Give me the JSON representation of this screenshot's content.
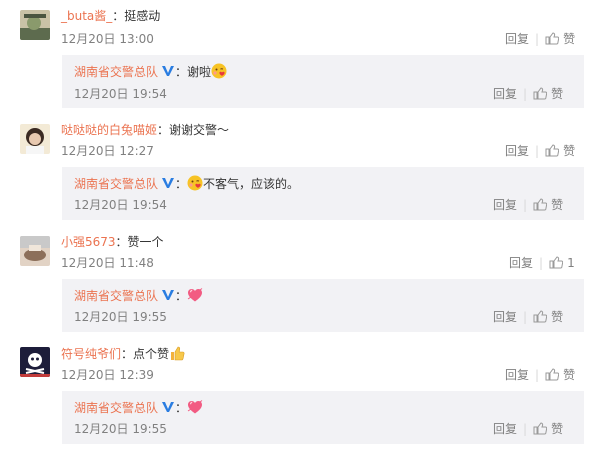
{
  "comments": [
    {
      "user": "_buta酱_",
      "text": "：挺感动",
      "time": "12月20日 13:00",
      "reply_label": "回复",
      "like_label": "赞",
      "like_count": "",
      "avatar_colors": [
        "#5d6b4e",
        "#8a9a6c",
        "#c9c2a6"
      ],
      "reply": {
        "user": "湖南省交警总队",
        "text": "：谢啦",
        "emoji": "kiss-emoji",
        "time": "12月20日 19:54",
        "reply_label": "回复",
        "like_label": "赞"
      }
    },
    {
      "user": "哒哒哒的白兔喵姬",
      "text": "：谢谢交警～",
      "time": "12月20日 12:27",
      "reply_label": "回复",
      "like_label": "赞",
      "like_count": "",
      "avatar_colors": [
        "#f3ead6",
        "#3b2a22",
        "#e8c9b0"
      ],
      "reply": {
        "user": "湖南省交警总队",
        "text": "不客气，应该的。",
        "prefix": "：",
        "emoji": "kiss-emoji",
        "time": "12月20日 19:54",
        "reply_label": "回复",
        "like_label": "赞"
      }
    },
    {
      "user": "小强5673",
      "text": "：赞一个",
      "time": "12月20日 11:48",
      "reply_label": "回复",
      "like_label": "",
      "like_count": "1",
      "avatar_colors": [
        "#c9c9c9",
        "#8c6f5a",
        "#e2d3c5"
      ],
      "reply": {
        "user": "湖南省交警总队",
        "text": "：",
        "emoji": "heart-emoji",
        "time": "12月20日 19:55",
        "reply_label": "回复",
        "like_label": "赞"
      }
    },
    {
      "user": "符号纯爷们",
      "text": "：点个赞",
      "text_emoji": "thumbs-up-emoji",
      "time": "12月20日 12:39",
      "reply_label": "回复",
      "like_label": "赞",
      "like_count": "",
      "avatar_colors": [
        "#1d1d3a",
        "#ffffff",
        "#c23b3b"
      ],
      "reply": {
        "user": "湖南省交警总队",
        "text": "：",
        "emoji": "heart-emoji",
        "time": "12月20日 19:55",
        "reply_label": "回复",
        "like_label": "赞"
      }
    }
  ],
  "colors": {
    "username": "#eb7350",
    "verified_badge": "#2a7de1",
    "reply_background": "#f2f2f5",
    "meta_text": "#808080"
  }
}
